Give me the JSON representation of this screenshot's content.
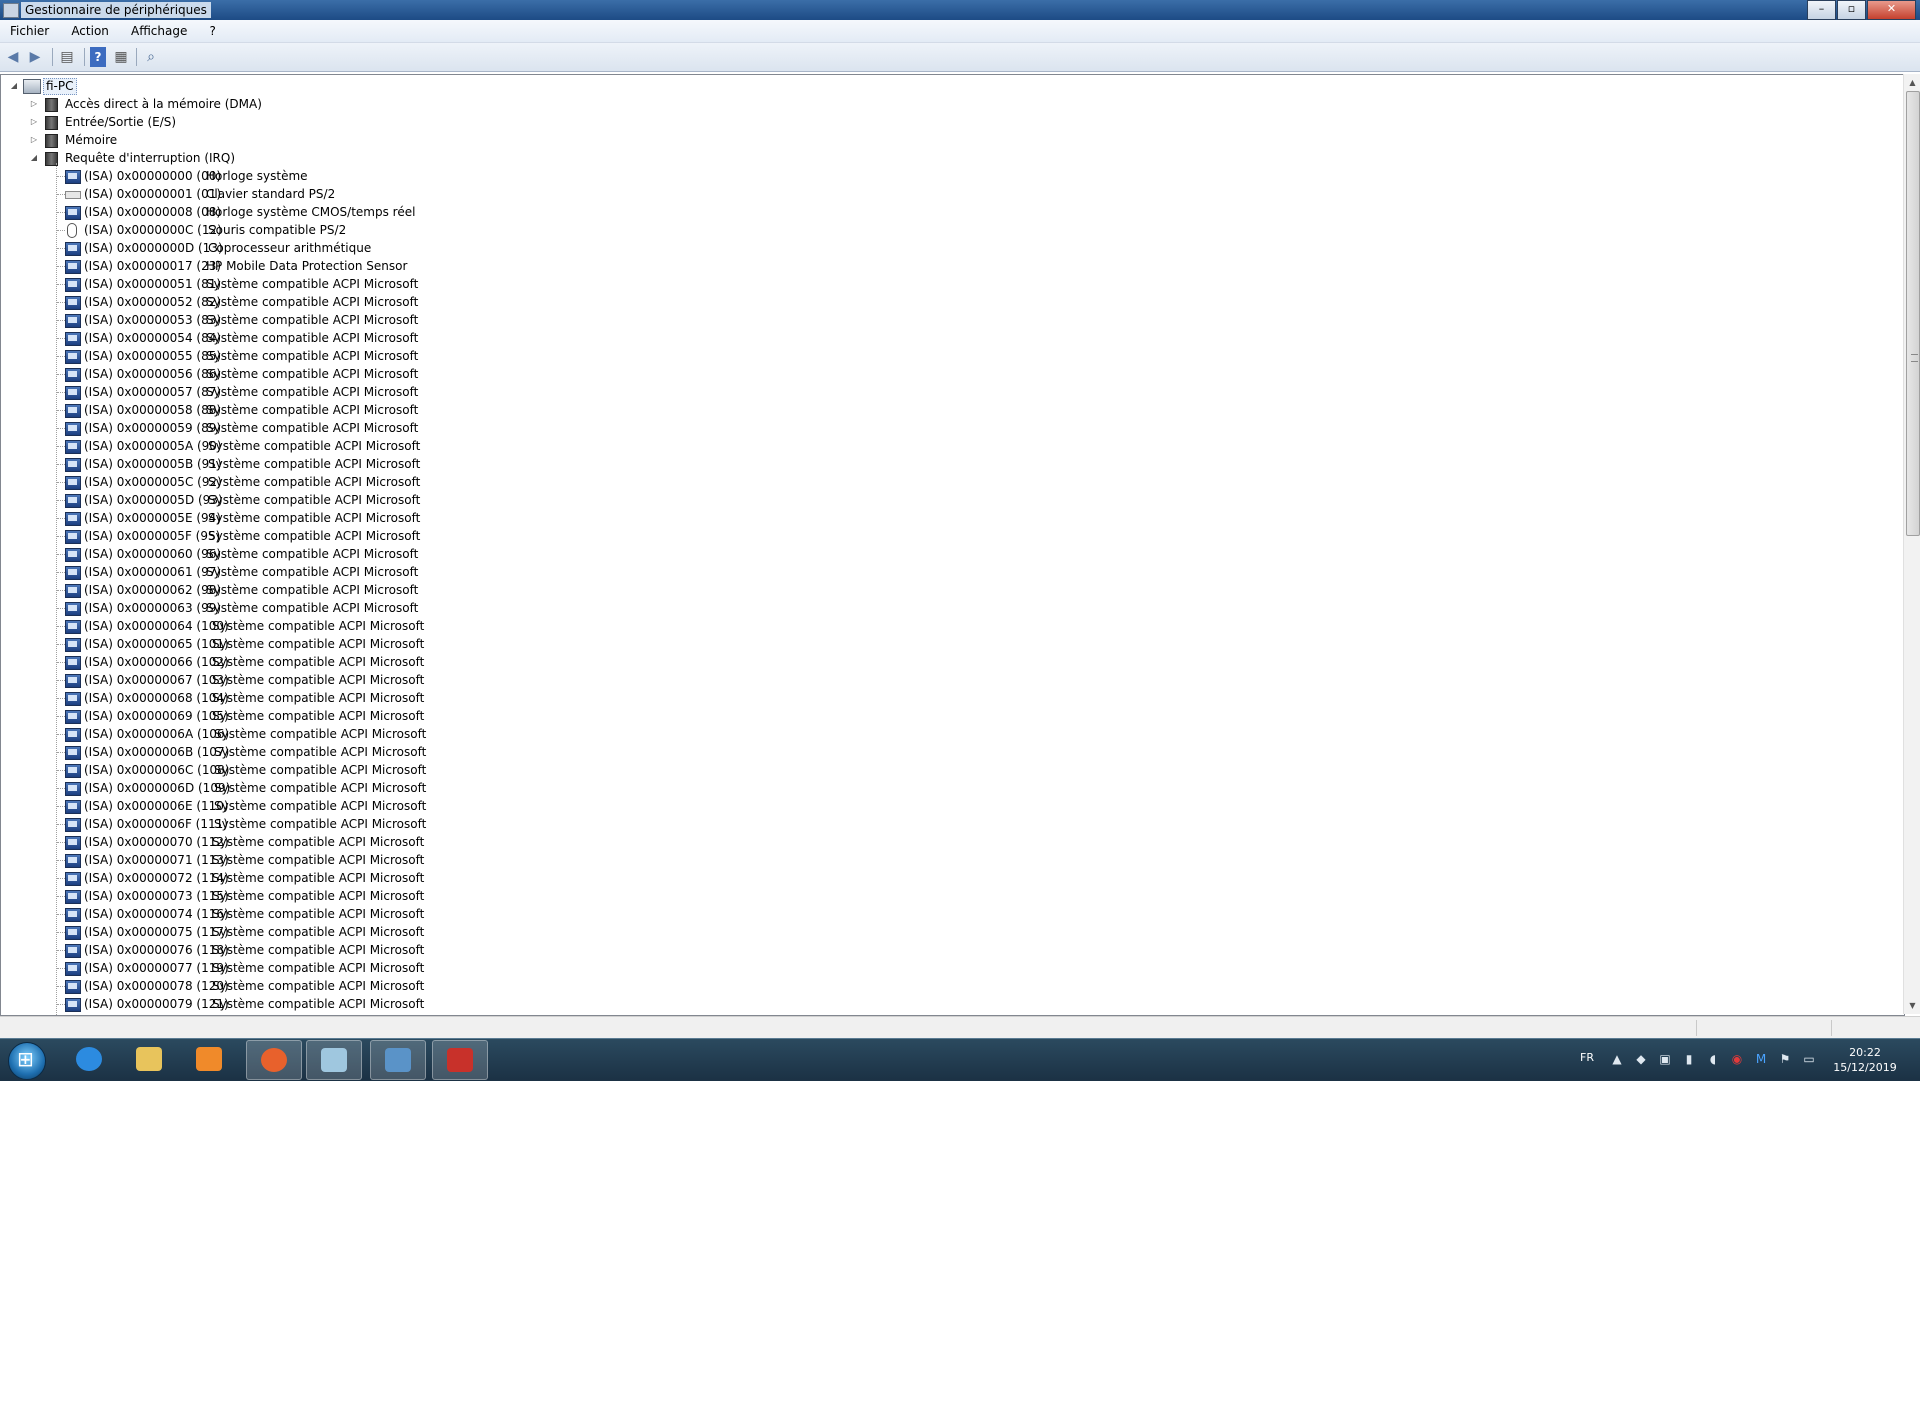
{
  "window": {
    "title": "Gestionnaire de périphériques"
  },
  "menu": {
    "items": [
      "Fichier",
      "Action",
      "Affichage",
      "?"
    ]
  },
  "toolbar": {
    "buttons": [
      "back-arrow-icon",
      "forward-arrow-icon",
      "tree-view-icon",
      "help-icon",
      "properties-icon",
      "scan-hardware-icon"
    ]
  },
  "tree": {
    "root": "fi-PC",
    "categories": [
      {
        "label": "Accès direct à la mémoire (DMA)",
        "expanded": false
      },
      {
        "label": "Entrée/Sortie (E/S)",
        "expanded": false
      },
      {
        "label": "Mémoire",
        "expanded": false
      },
      {
        "label": "Requête d'interruption (IRQ)",
        "expanded": true
      }
    ],
    "irq_items": [
      {
        "irq": "(ISA) 0x00000000 (00)",
        "device": "Horloge système",
        "icon": "system-device-icon"
      },
      {
        "irq": "(ISA) 0x00000001 (01)",
        "device": "Clavier standard PS/2",
        "icon": "keyboard-icon"
      },
      {
        "irq": "(ISA) 0x00000008 (08)",
        "device": "Horloge système CMOS/temps réel",
        "icon": "system-device-icon"
      },
      {
        "irq": "(ISA) 0x0000000C (12)",
        "device": "Souris compatible PS/2",
        "icon": "mouse-icon"
      },
      {
        "irq": "(ISA) 0x0000000D (13)",
        "device": "Coprocesseur arithmétique",
        "icon": "system-device-icon"
      },
      {
        "irq": "(ISA) 0x00000017 (23)",
        "device": "HP Mobile Data Protection Sensor",
        "icon": "system-device-icon"
      },
      {
        "irq": "(ISA) 0x00000051 (81)",
        "device": "Système compatible ACPI Microsoft",
        "icon": "system-device-icon"
      },
      {
        "irq": "(ISA) 0x00000052 (82)",
        "device": "Système compatible ACPI Microsoft",
        "icon": "system-device-icon"
      },
      {
        "irq": "(ISA) 0x00000053 (83)",
        "device": "Système compatible ACPI Microsoft",
        "icon": "system-device-icon"
      },
      {
        "irq": "(ISA) 0x00000054 (84)",
        "device": "Système compatible ACPI Microsoft",
        "icon": "system-device-icon"
      },
      {
        "irq": "(ISA) 0x00000055 (85)",
        "device": "Système compatible ACPI Microsoft",
        "icon": "system-device-icon"
      },
      {
        "irq": "(ISA) 0x00000056 (86)",
        "device": "Système compatible ACPI Microsoft",
        "icon": "system-device-icon"
      },
      {
        "irq": "(ISA) 0x00000057 (87)",
        "device": "Système compatible ACPI Microsoft",
        "icon": "system-device-icon"
      },
      {
        "irq": "(ISA) 0x00000058 (88)",
        "device": "Système compatible ACPI Microsoft",
        "icon": "system-device-icon"
      },
      {
        "irq": "(ISA) 0x00000059 (89)",
        "device": "Système compatible ACPI Microsoft",
        "icon": "system-device-icon"
      },
      {
        "irq": "(ISA) 0x0000005A (90)",
        "device": "Système compatible ACPI Microsoft",
        "icon": "system-device-icon"
      },
      {
        "irq": "(ISA) 0x0000005B (91)",
        "device": "Système compatible ACPI Microsoft",
        "icon": "system-device-icon"
      },
      {
        "irq": "(ISA) 0x0000005C (92)",
        "device": "Système compatible ACPI Microsoft",
        "icon": "system-device-icon"
      },
      {
        "irq": "(ISA) 0x0000005D (93)",
        "device": "Système compatible ACPI Microsoft",
        "icon": "system-device-icon"
      },
      {
        "irq": "(ISA) 0x0000005E (94)",
        "device": "Système compatible ACPI Microsoft",
        "icon": "system-device-icon"
      },
      {
        "irq": "(ISA) 0x0000005F (95)",
        "device": "Système compatible ACPI Microsoft",
        "icon": "system-device-icon"
      },
      {
        "irq": "(ISA) 0x00000060 (96)",
        "device": "Système compatible ACPI Microsoft",
        "icon": "system-device-icon"
      },
      {
        "irq": "(ISA) 0x00000061 (97)",
        "device": "Système compatible ACPI Microsoft",
        "icon": "system-device-icon"
      },
      {
        "irq": "(ISA) 0x00000062 (98)",
        "device": "Système compatible ACPI Microsoft",
        "icon": "system-device-icon"
      },
      {
        "irq": "(ISA) 0x00000063 (99)",
        "device": "Système compatible ACPI Microsoft",
        "icon": "system-device-icon"
      },
      {
        "irq": "(ISA) 0x00000064 (100)",
        "device": "Système compatible ACPI Microsoft",
        "icon": "system-device-icon"
      },
      {
        "irq": "(ISA) 0x00000065 (101)",
        "device": "Système compatible ACPI Microsoft",
        "icon": "system-device-icon"
      },
      {
        "irq": "(ISA) 0x00000066 (102)",
        "device": "Système compatible ACPI Microsoft",
        "icon": "system-device-icon"
      },
      {
        "irq": "(ISA) 0x00000067 (103)",
        "device": "Système compatible ACPI Microsoft",
        "icon": "system-device-icon"
      },
      {
        "irq": "(ISA) 0x00000068 (104)",
        "device": "Système compatible ACPI Microsoft",
        "icon": "system-device-icon"
      },
      {
        "irq": "(ISA) 0x00000069 (105)",
        "device": "Système compatible ACPI Microsoft",
        "icon": "system-device-icon"
      },
      {
        "irq": "(ISA) 0x0000006A (106)",
        "device": "Système compatible ACPI Microsoft",
        "icon": "system-device-icon"
      },
      {
        "irq": "(ISA) 0x0000006B (107)",
        "device": "Système compatible ACPI Microsoft",
        "icon": "system-device-icon"
      },
      {
        "irq": "(ISA) 0x0000006C (108)",
        "device": "Système compatible ACPI Microsoft",
        "icon": "system-device-icon"
      },
      {
        "irq": "(ISA) 0x0000006D (109)",
        "device": "Système compatible ACPI Microsoft",
        "icon": "system-device-icon"
      },
      {
        "irq": "(ISA) 0x0000006E (110)",
        "device": "Système compatible ACPI Microsoft",
        "icon": "system-device-icon"
      },
      {
        "irq": "(ISA) 0x0000006F (111)",
        "device": "Système compatible ACPI Microsoft",
        "icon": "system-device-icon"
      },
      {
        "irq": "(ISA) 0x00000070 (112)",
        "device": "Système compatible ACPI Microsoft",
        "icon": "system-device-icon"
      },
      {
        "irq": "(ISA) 0x00000071 (113)",
        "device": "Système compatible ACPI Microsoft",
        "icon": "system-device-icon"
      },
      {
        "irq": "(ISA) 0x00000072 (114)",
        "device": "Système compatible ACPI Microsoft",
        "icon": "system-device-icon"
      },
      {
        "irq": "(ISA) 0x00000073 (115)",
        "device": "Système compatible ACPI Microsoft",
        "icon": "system-device-icon"
      },
      {
        "irq": "(ISA) 0x00000074 (116)",
        "device": "Système compatible ACPI Microsoft",
        "icon": "system-device-icon"
      },
      {
        "irq": "(ISA) 0x00000075 (117)",
        "device": "Système compatible ACPI Microsoft",
        "icon": "system-device-icon"
      },
      {
        "irq": "(ISA) 0x00000076 (118)",
        "device": "Système compatible ACPI Microsoft",
        "icon": "system-device-icon"
      },
      {
        "irq": "(ISA) 0x00000077 (119)",
        "device": "Système compatible ACPI Microsoft",
        "icon": "system-device-icon"
      },
      {
        "irq": "(ISA) 0x00000078 (120)",
        "device": "Système compatible ACPI Microsoft",
        "icon": "system-device-icon"
      },
      {
        "irq": "(ISA) 0x00000079 (121)",
        "device": "Système compatible ACPI Microsoft",
        "icon": "system-device-icon"
      }
    ]
  },
  "taskbar": {
    "apps": [
      {
        "name": "internet-explorer-icon",
        "color": "#2c8be0"
      },
      {
        "name": "file-explorer-icon",
        "color": "#e8c45c"
      },
      {
        "name": "media-player-icon",
        "color": "#f08a2a"
      },
      {
        "name": "firefox-icon",
        "color": "#e8612c"
      },
      {
        "name": "notepad-icon",
        "color": "#9fc7df"
      },
      {
        "name": "control-panel-icon",
        "color": "#5a93c8"
      },
      {
        "name": "device-manager-icon",
        "color": "#c8312a"
      }
    ],
    "tray": {
      "language": "FR",
      "icons": [
        "network-icon",
        "security-icon",
        "usb-icon",
        "battery-icon",
        "volume-icon",
        "antivirus-icon",
        "malwarebytes-icon",
        "action-center-icon",
        "show-desktop-icon"
      ],
      "time": "20:22",
      "date": "15/12/2019"
    }
  }
}
